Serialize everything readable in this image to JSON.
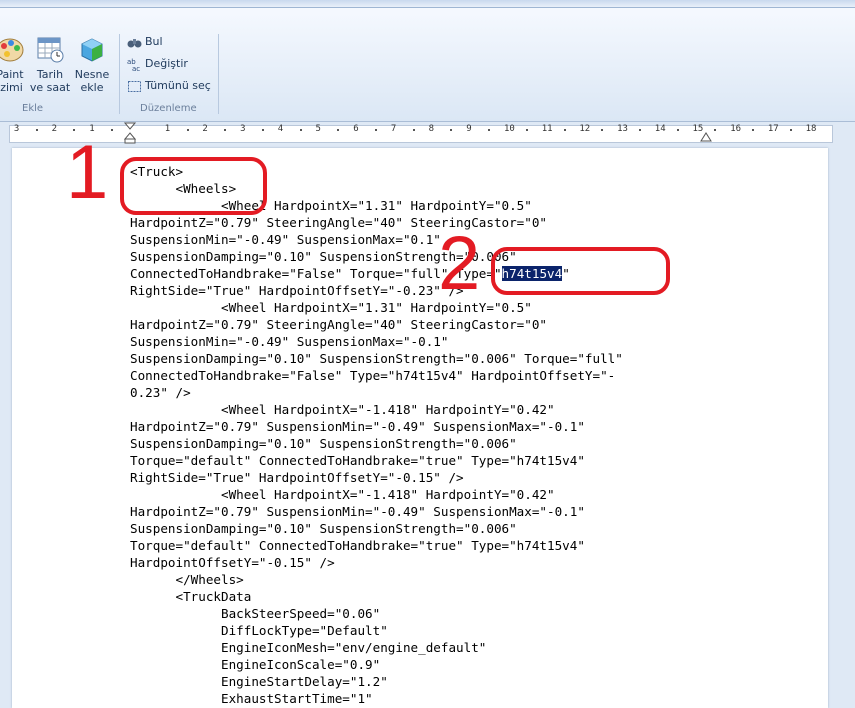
{
  "ribbon": {
    "buttons": [
      {
        "label": "Paint\nizimi",
        "icon": "paint-icon"
      },
      {
        "label": "Tarih\nve saat",
        "icon": "calendar-clock-icon"
      },
      {
        "label": "Nesne\nekle",
        "icon": "insert-object-icon"
      }
    ],
    "group_insert": "Ekle",
    "group_edit": "Düzenleme",
    "find": "Bul",
    "replace": "Değiştir",
    "select_all": "Tümünü seç"
  },
  "ruler": {
    "labels": [
      "3",
      "2",
      "1",
      "1",
      "2",
      "3",
      "4",
      "5",
      "6",
      "7",
      "8",
      "9",
      "10",
      "11",
      "12",
      "13",
      "14",
      "15",
      "16",
      "17",
      "18"
    ]
  },
  "document": {
    "lines": [
      "<Truck>",
      "      <Wheels>",
      "            <Wheel HardpointX=\"1.31\" HardpointY=\"0.5\"",
      "HardpointZ=\"0.79\" SteeringAngle=\"40\" SteeringCastor=\"0\"",
      "SuspensionMin=\"-0.49\" SuspensionMax=\"0.1\"",
      "SuspensionDamping=\"0.10\" SuspensionStrength=\"0.006\"",
      "ConnectedToHandbrake=\"False\" Torque=\"full\" Type=\"",
      "RightSide=\"True\" HardpointOffsetY=\"-0.23\" />",
      "            <Wheel HardpointX=\"1.31\" HardpointY=\"0.5\"",
      "HardpointZ=\"0.79\" SteeringAngle=\"40\" SteeringCastor=\"0\"",
      "SuspensionMin=\"-0.49\" SuspensionMax=\"-0.1\"",
      "SuspensionDamping=\"0.10\" SuspensionStrength=\"0.006\" Torque=\"full\"",
      "ConnectedToHandbrake=\"False\" Type=\"h74t15v4\" HardpointOffsetY=\"-",
      "0.23\" />",
      "            <Wheel HardpointX=\"-1.418\" HardpointY=\"0.42\"",
      "HardpointZ=\"0.79\" SuspensionMin=\"-0.49\" SuspensionMax=\"-0.1\"",
      "SuspensionDamping=\"0.10\" SuspensionStrength=\"0.006\"",
      "Torque=\"default\" ConnectedToHandbrake=\"true\" Type=\"h74t15v4\"",
      "RightSide=\"True\" HardpointOffsetY=\"-0.15\" />",
      "            <Wheel HardpointX=\"-1.418\" HardpointY=\"0.42\"",
      "HardpointZ=\"0.79\" SuspensionMin=\"-0.49\" SuspensionMax=\"-0.1\"",
      "SuspensionDamping=\"0.10\" SuspensionStrength=\"0.006\"",
      "Torque=\"default\" ConnectedToHandbrake=\"true\" Type=\"h74t15v4\"",
      "HardpointOffsetY=\"-0.15\" />",
      "      </Wheels>",
      "      <TruckData",
      "            BackSteerSpeed=\"0.06\"",
      "            DiffLockType=\"Default\"",
      "            EngineIconMesh=\"env/engine_default\"",
      "            EngineIconScale=\"0.9\"",
      "            EngineStartDelay=\"1.2\"",
      "            ExhaustStartTime=\"1\""
    ],
    "selected_text": "h74t15v4",
    "after_selected": "\""
  },
  "annotations": {
    "marker1": "1",
    "marker2": "2"
  },
  "colors": {
    "annotation": "#e31b23",
    "selection": "#0b246b"
  }
}
